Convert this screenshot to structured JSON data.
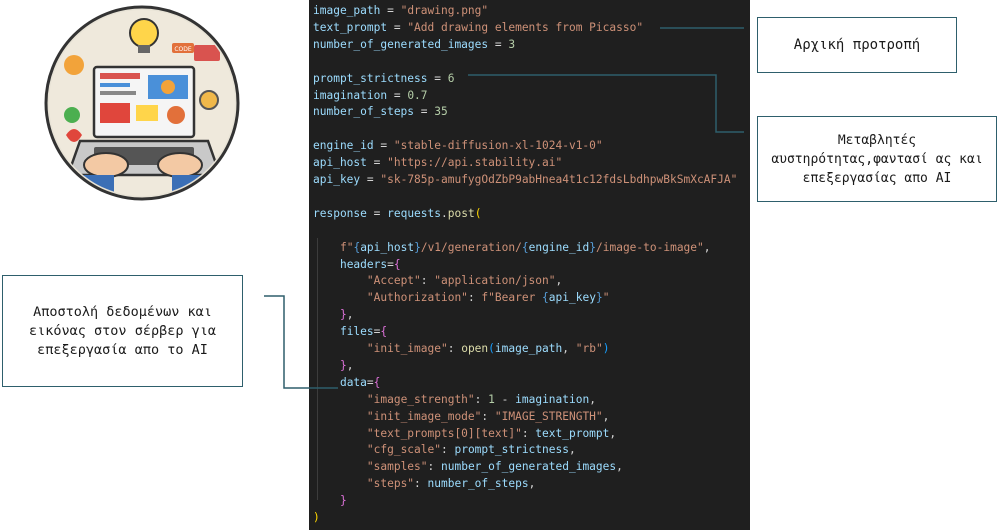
{
  "colors": {
    "editor_bg": "#1f1f1f",
    "variable": "#9cdcfe",
    "string": "#ce9178",
    "number": "#b5cea8",
    "function": "#dcdcaa",
    "connector": "#2e5f6c"
  },
  "illustration": {
    "icon": "laptop-design-illustration",
    "badge_text": "CODE"
  },
  "annotations": {
    "initial_prompt": "Αρχική προτροπή",
    "variables": "Μεταβλητές αυστηρότητας,φαντασί ας και επεξεργασίας απο AI",
    "send_data": "Αποστολή δεδομένων και εικόνας στον σέρβερ για επεξεργασία απο το AI"
  },
  "code_lines": [
    [
      [
        "var",
        "image_path"
      ],
      [
        "op",
        " = "
      ],
      [
        "str",
        "\"drawing.png\""
      ]
    ],
    [
      [
        "var",
        "text_prompt"
      ],
      [
        "op",
        " = "
      ],
      [
        "str",
        "\"Add drawing elements from Picasso\""
      ]
    ],
    [
      [
        "var",
        "number_of_generated_images"
      ],
      [
        "op",
        " = "
      ],
      [
        "num",
        "3"
      ]
    ],
    [],
    [
      [
        "var",
        "prompt_strictness"
      ],
      [
        "op",
        " = "
      ],
      [
        "num",
        "6"
      ]
    ],
    [
      [
        "var",
        "imagination"
      ],
      [
        "op",
        " = "
      ],
      [
        "num",
        "0.7"
      ]
    ],
    [
      [
        "var",
        "number_of_steps"
      ],
      [
        "op",
        " = "
      ],
      [
        "num",
        "35"
      ]
    ],
    [],
    [
      [
        "var",
        "engine_id"
      ],
      [
        "op",
        " = "
      ],
      [
        "str",
        "\"stable-diffusion-xl-1024-v1-0\""
      ]
    ],
    [
      [
        "var",
        "api_host"
      ],
      [
        "op",
        " = "
      ],
      [
        "str",
        "\"https://api.stability.ai\""
      ]
    ],
    [
      [
        "var",
        "api_key"
      ],
      [
        "op",
        " = "
      ],
      [
        "str",
        "\"sk-785p-amufygOdZbP9abHnea4t1c12fdsLbdhpwBkSmXcAFJA\""
      ]
    ],
    [],
    [
      [
        "var",
        "response"
      ],
      [
        "op",
        " = "
      ],
      [
        "var",
        "requests"
      ],
      [
        "op",
        "."
      ],
      [
        "fn",
        "post"
      ],
      [
        "b1",
        "("
      ]
    ],
    [],
    [
      [
        "op",
        "    "
      ],
      [
        "str",
        "f\""
      ],
      [
        "esc",
        "{"
      ],
      [
        "var",
        "api_host"
      ],
      [
        "esc",
        "}"
      ],
      [
        "str",
        "/v1/generation/"
      ],
      [
        "esc",
        "{"
      ],
      [
        "var",
        "engine_id"
      ],
      [
        "esc",
        "}"
      ],
      [
        "str",
        "/image-to-image\""
      ],
      [
        "op",
        ","
      ]
    ],
    [
      [
        "op",
        "    "
      ],
      [
        "var",
        "headers"
      ],
      [
        "op",
        "="
      ],
      [
        "b2",
        "{"
      ]
    ],
    [
      [
        "op",
        "        "
      ],
      [
        "str",
        "\"Accept\""
      ],
      [
        "op",
        ": "
      ],
      [
        "str",
        "\"application/json\""
      ],
      [
        "op",
        ","
      ]
    ],
    [
      [
        "op",
        "        "
      ],
      [
        "str",
        "\"Authorization\""
      ],
      [
        "op",
        ": "
      ],
      [
        "str",
        "f\"Bearer "
      ],
      [
        "esc",
        "{"
      ],
      [
        "var",
        "api_key"
      ],
      [
        "esc",
        "}"
      ],
      [
        "str",
        "\""
      ]
    ],
    [
      [
        "op",
        "    "
      ],
      [
        "b2",
        "}"
      ],
      [
        "op",
        ","
      ]
    ],
    [
      [
        "op",
        "    "
      ],
      [
        "var",
        "files"
      ],
      [
        "op",
        "="
      ],
      [
        "b2",
        "{"
      ]
    ],
    [
      [
        "op",
        "        "
      ],
      [
        "str",
        "\"init_image\""
      ],
      [
        "op",
        ": "
      ],
      [
        "fn",
        "open"
      ],
      [
        "b3",
        "("
      ],
      [
        "var",
        "image_path"
      ],
      [
        "op",
        ", "
      ],
      [
        "str",
        "\"rb\""
      ],
      [
        "b3",
        ")"
      ]
    ],
    [
      [
        "op",
        "    "
      ],
      [
        "b2",
        "}"
      ],
      [
        "op",
        ","
      ]
    ],
    [
      [
        "op",
        "    "
      ],
      [
        "var",
        "data"
      ],
      [
        "op",
        "="
      ],
      [
        "b2",
        "{"
      ]
    ],
    [
      [
        "op",
        "        "
      ],
      [
        "str",
        "\"image_strength\""
      ],
      [
        "op",
        ": "
      ],
      [
        "num",
        "1"
      ],
      [
        "op",
        " - "
      ],
      [
        "var",
        "imagination"
      ],
      [
        "op",
        ","
      ]
    ],
    [
      [
        "op",
        "        "
      ],
      [
        "str",
        "\"init_image_mode\""
      ],
      [
        "op",
        ": "
      ],
      [
        "str",
        "\"IMAGE_STRENGTH\""
      ],
      [
        "op",
        ","
      ]
    ],
    [
      [
        "op",
        "        "
      ],
      [
        "str",
        "\"text_prompts[0][text]\""
      ],
      [
        "op",
        ": "
      ],
      [
        "var",
        "text_prompt"
      ],
      [
        "op",
        ","
      ]
    ],
    [
      [
        "op",
        "        "
      ],
      [
        "str",
        "\"cfg_scale\""
      ],
      [
        "op",
        ": "
      ],
      [
        "var",
        "prompt_strictness"
      ],
      [
        "op",
        ","
      ]
    ],
    [
      [
        "op",
        "        "
      ],
      [
        "str",
        "\"samples\""
      ],
      [
        "op",
        ": "
      ],
      [
        "var",
        "number_of_generated_images"
      ],
      [
        "op",
        ","
      ]
    ],
    [
      [
        "op",
        "        "
      ],
      [
        "str",
        "\"steps\""
      ],
      [
        "op",
        ": "
      ],
      [
        "var",
        "number_of_steps"
      ],
      [
        "op",
        ","
      ]
    ],
    [
      [
        "op",
        "    "
      ],
      [
        "b2",
        "}"
      ]
    ],
    [
      [
        "b1",
        ")"
      ]
    ]
  ]
}
